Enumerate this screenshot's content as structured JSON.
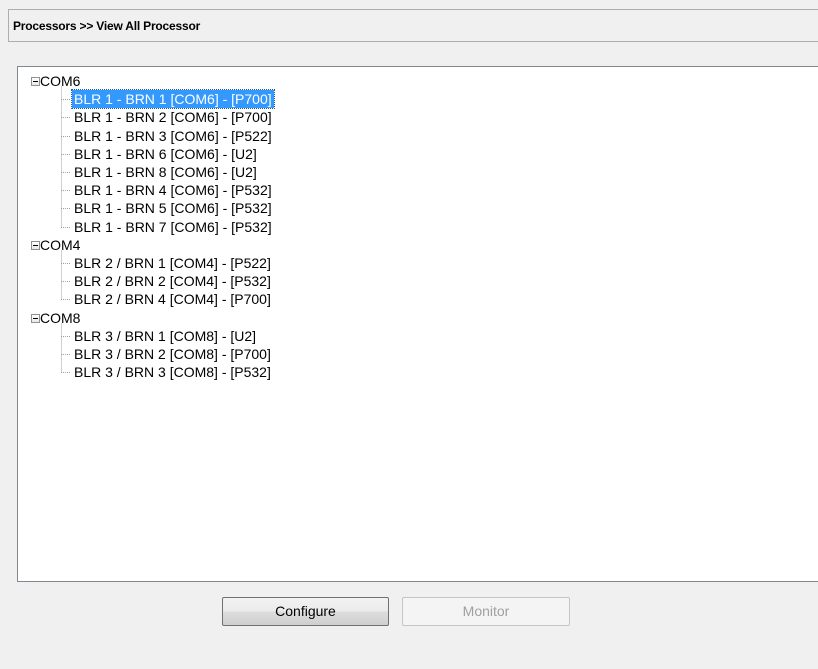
{
  "header": {
    "title": "Processors >> View All Processor"
  },
  "tree": {
    "groups": [
      {
        "label": "COM6",
        "expanded": true,
        "children": [
          {
            "label": "BLR 1 - BRN 1 [COM6] - [P700]",
            "selected": true
          },
          {
            "label": "BLR 1 - BRN 2 [COM6] - [P700]"
          },
          {
            "label": "BLR 1 - BRN 3 [COM6] - [P522]"
          },
          {
            "label": "BLR 1 - BRN 6 [COM6] - [U2]"
          },
          {
            "label": "BLR 1 - BRN 8 [COM6] - [U2]"
          },
          {
            "label": "BLR 1 - BRN 4 [COM6] - [P532]"
          },
          {
            "label": "BLR 1 - BRN 5 [COM6] - [P532]"
          },
          {
            "label": "BLR 1 - BRN 7 [COM6] - [P532]"
          }
        ]
      },
      {
        "label": "COM4",
        "expanded": true,
        "children": [
          {
            "label": "BLR 2 / BRN 1 [COM4] - [P522]"
          },
          {
            "label": "BLR 2 / BRN 2 [COM4] - [P532]"
          },
          {
            "label": "BLR 2 / BRN 4 [COM4] - [P700]"
          }
        ]
      },
      {
        "label": "COM8",
        "expanded": true,
        "children": [
          {
            "label": "BLR 3 / BRN 1 [COM8] - [U2]"
          },
          {
            "label": "BLR 3 / BRN 2 [COM8] - [P700]"
          },
          {
            "label": "BLR 3 / BRN 3 [COM8] - [P532]"
          }
        ]
      }
    ]
  },
  "buttons": {
    "configure": {
      "label": "Configure",
      "enabled": true
    },
    "monitor": {
      "label": "Monitor",
      "enabled": false
    }
  },
  "colors": {
    "selection": "#3399ff",
    "selection_text": "#ffffff",
    "disabled_text": "#a0a0a0"
  },
  "icons": {
    "expander": "minus-box-icon"
  }
}
